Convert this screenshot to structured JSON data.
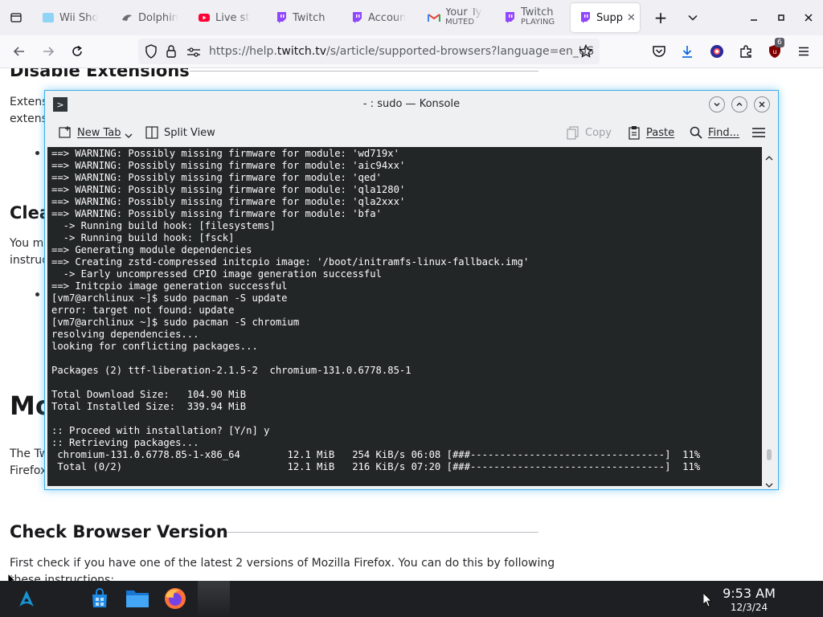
{
  "browser": {
    "tabs": [
      {
        "title": "Wii Sho",
        "icon": "wii-shop-icon"
      },
      {
        "title": "Dolphin",
        "icon": "dolphin-icon"
      },
      {
        "title": "Live st",
        "icon": "youtube-icon"
      },
      {
        "title": "Twitch",
        "icon": "twitch-icon"
      },
      {
        "title": "Accoun",
        "icon": "twitch-icon"
      },
      {
        "title": "Your Ty",
        "subtitle": "MUTED",
        "icon": "gmail-icon"
      },
      {
        "title": "Twitch",
        "subtitle": "PLAYING",
        "icon": "twitch-icon"
      },
      {
        "title": "Supp",
        "icon": "twitch-icon",
        "active": true
      }
    ],
    "new_tab_label": "+",
    "url": {
      "prefix": "https://help.",
      "domain": "twitch.tv",
      "suffix": "/s/article/supported-browsers?language=en_US"
    },
    "extension_badge": "6"
  },
  "page": {
    "heading_extensions": "Disable Extensions",
    "ext_text_1": "Extens",
    "ext_text_2": "extens",
    "heading_clear": "Clea",
    "clear_text_1": "You ma",
    "clear_text_2": "instruc",
    "heading_mo": "Mo",
    "mo_text_1": "The Tw",
    "mo_text_2": "Firefox",
    "heading_check": "Check Browser Version",
    "check_text_1": "First check if you have one of the latest 2 versions of Mozilla Firefox. You can do this by following",
    "check_text_2": "these instructions:"
  },
  "konsole": {
    "title": "- : sudo — Konsole",
    "toolbar": {
      "new_tab": "New Tab",
      "split_view": "Split View",
      "copy": "Copy",
      "paste": "Paste",
      "find": "Find..."
    },
    "lines": [
      "==> WARNING: Possibly missing firmware for module: 'wd719x'",
      "==> WARNING: Possibly missing firmware for module: 'aic94xx'",
      "==> WARNING: Possibly missing firmware for module: 'qed'",
      "==> WARNING: Possibly missing firmware for module: 'qla1280'",
      "==> WARNING: Possibly missing firmware for module: 'qla2xxx'",
      "==> WARNING: Possibly missing firmware for module: 'bfa'",
      "  -> Running build hook: [filesystems]",
      "  -> Running build hook: [fsck]",
      "==> Generating module dependencies",
      "==> Creating zstd-compressed initcpio image: '/boot/initramfs-linux-fallback.img'",
      "  -> Early uncompressed CPIO image generation successful",
      "==> Initcpio image generation successful",
      "[vm7@archlinux ~]$ sudo pacman -S update",
      "error: target not found: update",
      "[vm7@archlinux ~]$ sudo pacman -S chromium",
      "resolving dependencies...",
      "looking for conflicting packages...",
      "",
      "Packages (2) ttf-liberation-2.1.5-2  chromium-131.0.6778.85-1",
      "",
      "Total Download Size:   104.90 MiB",
      "Total Installed Size:  339.94 MiB",
      "",
      ":: Proceed with installation? [Y/n] y",
      ":: Retrieving packages...",
      " chromium-131.0.6778.85-1-x86_64        12.1 MiB   254 KiB/s 06:08 [###---------------------------------]  11%",
      " Total (0/2)                            12.1 MiB   216 KiB/s 07:20 [###---------------------------------]  11%"
    ]
  },
  "taskbar": {
    "time": "9:53 AM",
    "date": "12/3/24"
  },
  "colors": {
    "accent": "#3daee9",
    "terminal_bg": "#232627",
    "twitch": "#9146ff"
  }
}
